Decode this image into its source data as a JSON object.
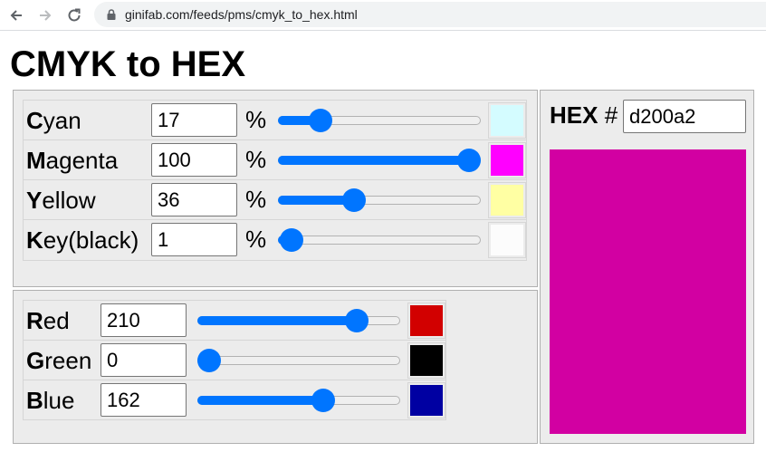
{
  "browser": {
    "url": "ginifab.com/feeds/pms/cmyk_to_hex.html"
  },
  "page": {
    "title": "CMYK to HEX"
  },
  "cmyk": {
    "rows": [
      {
        "initial": "C",
        "rest": "yan",
        "value": "17",
        "unit": "%",
        "level": 0.17,
        "swatch_color": "#d4fcff"
      },
      {
        "initial": "M",
        "rest": "agenta",
        "value": "100",
        "unit": "%",
        "level": 1.0,
        "swatch_color": "#ff00ff"
      },
      {
        "initial": "Y",
        "rest": "ellow",
        "value": "36",
        "unit": "%",
        "level": 0.36,
        "swatch_color": "#ffffa3"
      },
      {
        "initial": "K",
        "rest": "ey(black)",
        "value": "1",
        "unit": "%",
        "level": 0.01,
        "swatch_color": "#fcfcfc"
      }
    ]
  },
  "rgb": {
    "rows": [
      {
        "initial": "R",
        "rest": "ed",
        "value": "210",
        "level": 0.8235,
        "swatch_color": "#d20000"
      },
      {
        "initial": "G",
        "rest": "reen",
        "value": "0",
        "level": 0.0,
        "swatch_color": "#000000"
      },
      {
        "initial": "B",
        "rest": "lue",
        "value": "162",
        "level": 0.6353,
        "swatch_color": "#0000a2"
      }
    ]
  },
  "hex": {
    "label_bold": "HEX",
    "label_hash": " #",
    "value": "d200a2",
    "preview_color": "#d200a2"
  },
  "colors": {
    "slider_accent": "#0075ff",
    "panel_bg": "#ececec"
  }
}
